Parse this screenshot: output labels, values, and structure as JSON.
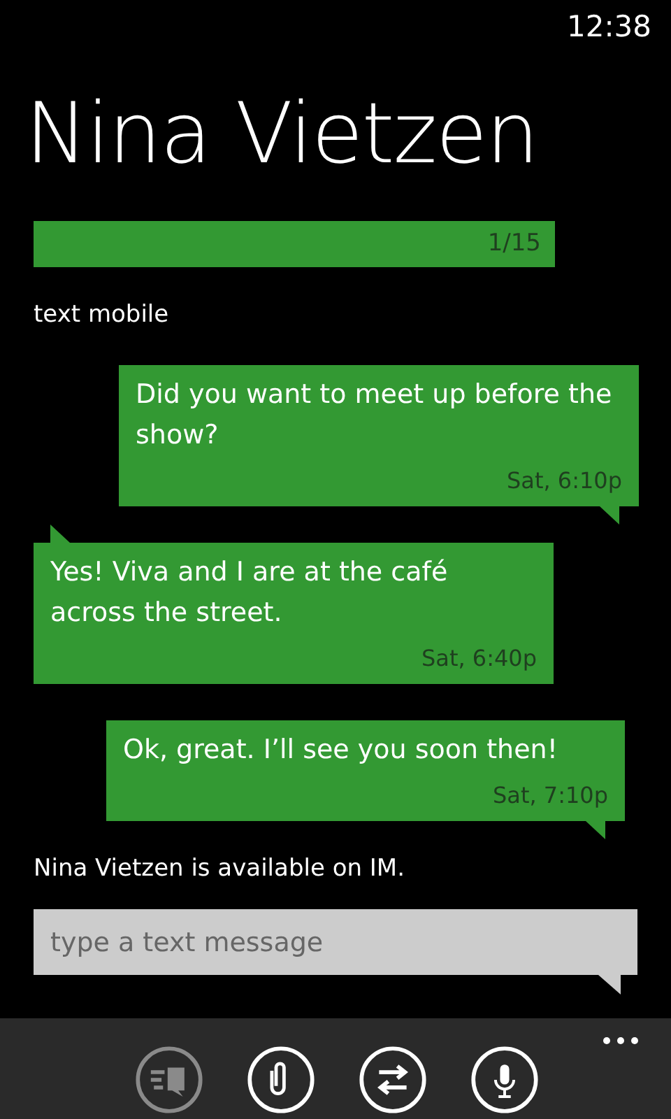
{
  "status_bar": {
    "time": "12:38"
  },
  "title": "Nina Vietzen",
  "thread_bar": {
    "counter": "1/15"
  },
  "channel": "text mobile",
  "messages": [
    {
      "kind": "sent",
      "text": "Did you want to meet up before the show?",
      "time": "Sat, 6:10p"
    },
    {
      "kind": "received",
      "text": "Yes! Viva and I are at the café across the street.",
      "time": "Sat, 6:40p"
    },
    {
      "kind": "sent",
      "text": "Ok, great. I’ll see you soon then!",
      "time": "Sat, 7:10p"
    }
  ],
  "presence": "Nina Vietzen is available on IM.",
  "compose": {
    "placeholder": "type a text message"
  },
  "app_bar": {
    "buttons": [
      {
        "kind": "send",
        "disabled": true
      },
      {
        "kind": "attach",
        "disabled": false
      },
      {
        "kind": "switch",
        "disabled": false
      },
      {
        "kind": "voice",
        "disabled": false
      }
    ]
  }
}
